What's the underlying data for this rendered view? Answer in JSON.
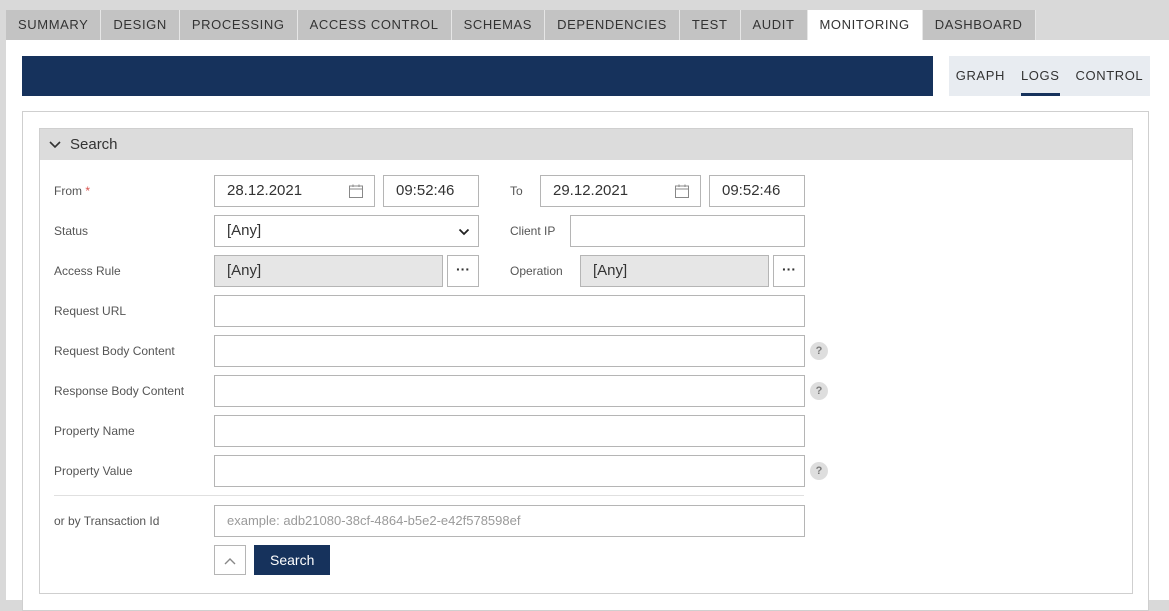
{
  "tabs": [
    {
      "label": "SUMMARY"
    },
    {
      "label": "DESIGN"
    },
    {
      "label": "PROCESSING"
    },
    {
      "label": "ACCESS CONTROL"
    },
    {
      "label": "SCHEMAS"
    },
    {
      "label": "DEPENDENCIES"
    },
    {
      "label": "TEST"
    },
    {
      "label": "AUDIT"
    },
    {
      "label": "MONITORING",
      "active": true
    },
    {
      "label": "DASHBOARD"
    }
  ],
  "subnav": [
    {
      "label": "GRAPH"
    },
    {
      "label": "LOGS",
      "active": true
    },
    {
      "label": "CONTROL"
    }
  ],
  "colors": {
    "header_bar": "#16325c",
    "primary_button": "#16325c",
    "required": "#d9534f"
  },
  "search": {
    "title": "Search",
    "from": {
      "label": "From",
      "required_mark": "*",
      "date": "28.12.2021",
      "time": "09:52:46"
    },
    "to": {
      "label": "To",
      "date": "29.12.2021",
      "time": "09:52:46"
    },
    "status": {
      "label": "Status",
      "value": "[Any]"
    },
    "client_ip": {
      "label": "Client IP",
      "value": ""
    },
    "access_rule": {
      "label": "Access Rule",
      "value": "[Any]",
      "browse": "···"
    },
    "operation": {
      "label": "Operation",
      "value": "[Any]",
      "browse": "···"
    },
    "request_url": {
      "label": "Request URL",
      "value": ""
    },
    "request_body": {
      "label": "Request Body Content",
      "value": "",
      "help": "?"
    },
    "response_body": {
      "label": "Response Body Content",
      "value": "",
      "help": "?"
    },
    "property_name": {
      "label": "Property Name",
      "value": ""
    },
    "property_value": {
      "label": "Property Value",
      "value": "",
      "help": "?"
    },
    "transaction": {
      "label": "or by Transaction Id",
      "placeholder": "example: adb21080-38cf-4864-b5e2-e42f578598ef"
    },
    "search_button": "Search"
  }
}
